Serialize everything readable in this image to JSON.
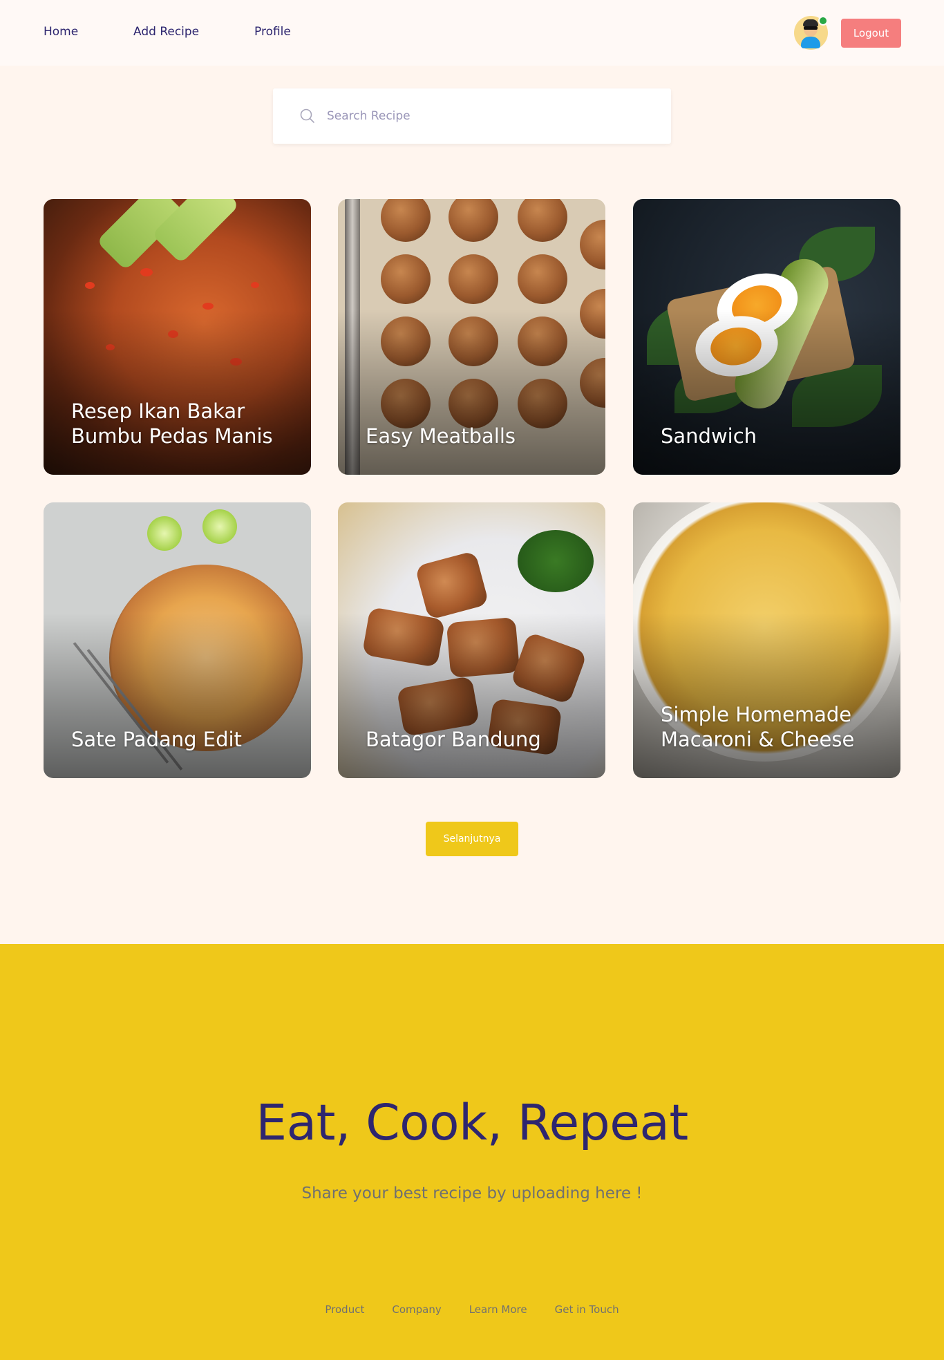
{
  "nav": {
    "links": [
      "Home",
      "Add Recipe",
      "Profile"
    ],
    "logout_label": "Logout",
    "avatar_status": "online"
  },
  "search": {
    "placeholder": "Search Recipe",
    "value": ""
  },
  "recipes": [
    {
      "title": "Resep Ikan Bakar Bumbu Pedas Manis"
    },
    {
      "title": "Easy Meatballs"
    },
    {
      "title": "Sandwich"
    },
    {
      "title": "Sate Padang Edit"
    },
    {
      "title": "Batagor Bandung"
    },
    {
      "title": "Simple Homemade Macaroni & Cheese"
    }
  ],
  "pagination": {
    "next_label": "Selanjutnya"
  },
  "footer": {
    "title": "Eat, Cook, Repeat",
    "subtitle": "Share your best recipe by uploading here !",
    "links": [
      "Product",
      "Company",
      "Learn More",
      "Get in Touch"
    ]
  },
  "colors": {
    "background": "#FFF5EE",
    "primary_text": "#2E266F",
    "accent_yellow": "#EFC81A",
    "logout_red": "#F57E7E",
    "status_green": "#29A845"
  }
}
